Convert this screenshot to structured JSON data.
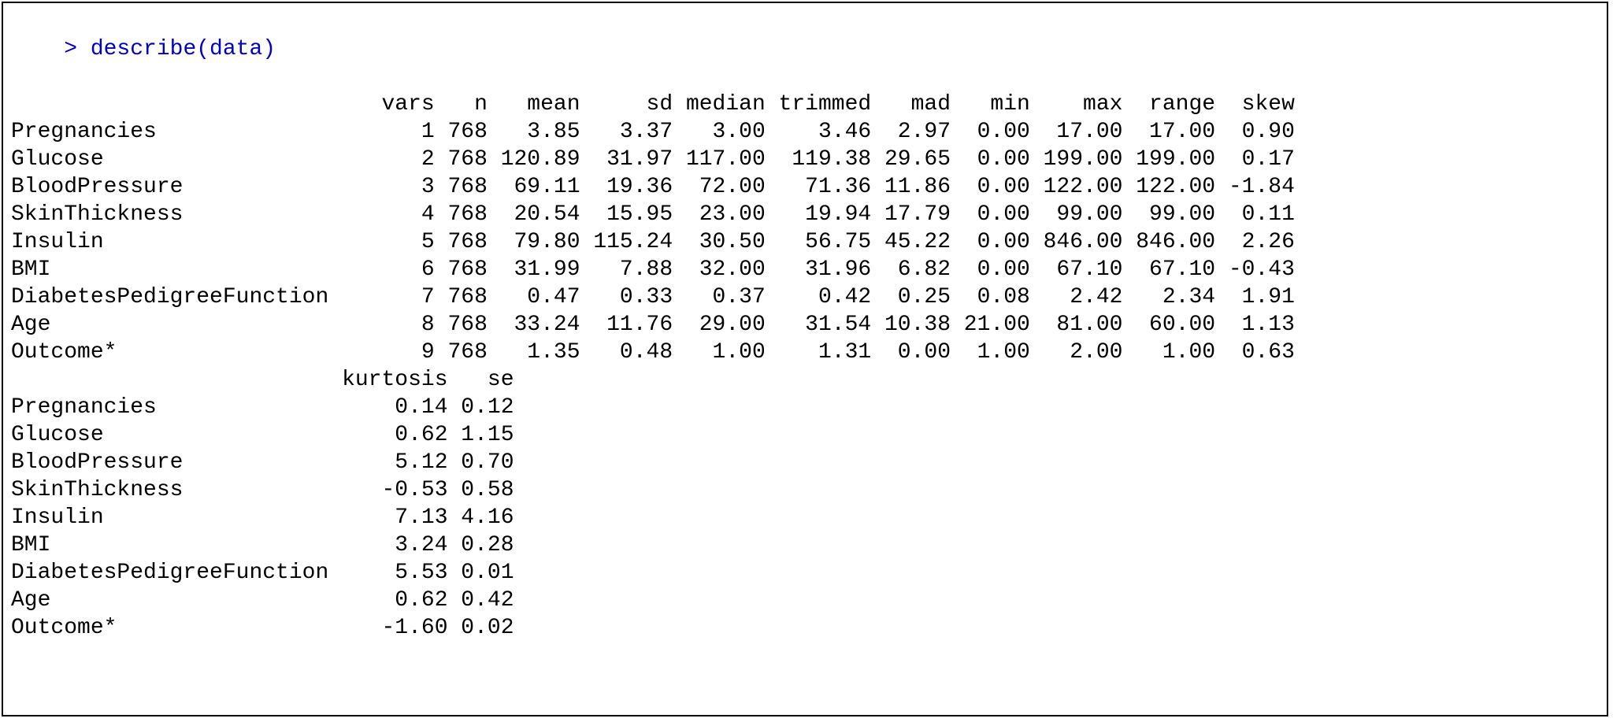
{
  "prompt_symbol": "> ",
  "command": "describe(data)",
  "block1": {
    "row_label_width": 24,
    "columns": [
      {
        "name": "vars",
        "width": 8
      },
      {
        "name": "n",
        "width": 4
      },
      {
        "name": "mean",
        "width": 7
      },
      {
        "name": "sd",
        "width": 7
      },
      {
        "name": "median",
        "width": 7
      },
      {
        "name": "trimmed",
        "width": 8
      },
      {
        "name": "mad",
        "width": 6
      },
      {
        "name": "min",
        "width": 6
      },
      {
        "name": "max",
        "width": 7
      },
      {
        "name": "range",
        "width": 7
      },
      {
        "name": "skew",
        "width": 6
      }
    ],
    "rows": [
      {
        "label": "Pregnancies",
        "vals": [
          "1",
          "768",
          "3.85",
          "3.37",
          "3.00",
          "3.46",
          "2.97",
          "0.00",
          "17.00",
          "17.00",
          "0.90"
        ]
      },
      {
        "label": "Glucose",
        "vals": [
          "2",
          "768",
          "120.89",
          "31.97",
          "117.00",
          "119.38",
          "29.65",
          "0.00",
          "199.00",
          "199.00",
          "0.17"
        ]
      },
      {
        "label": "BloodPressure",
        "vals": [
          "3",
          "768",
          "69.11",
          "19.36",
          "72.00",
          "71.36",
          "11.86",
          "0.00",
          "122.00",
          "122.00",
          "-1.84"
        ]
      },
      {
        "label": "SkinThickness",
        "vals": [
          "4",
          "768",
          "20.54",
          "15.95",
          "23.00",
          "19.94",
          "17.79",
          "0.00",
          "99.00",
          "99.00",
          "0.11"
        ]
      },
      {
        "label": "Insulin",
        "vals": [
          "5",
          "768",
          "79.80",
          "115.24",
          "30.50",
          "56.75",
          "45.22",
          "0.00",
          "846.00",
          "846.00",
          "2.26"
        ]
      },
      {
        "label": "BMI",
        "vals": [
          "6",
          "768",
          "31.99",
          "7.88",
          "32.00",
          "31.96",
          "6.82",
          "0.00",
          "67.10",
          "67.10",
          "-0.43"
        ]
      },
      {
        "label": "DiabetesPedigreeFunction",
        "vals": [
          "7",
          "768",
          "0.47",
          "0.33",
          "0.37",
          "0.42",
          "0.25",
          "0.08",
          "2.42",
          "2.34",
          "1.91"
        ]
      },
      {
        "label": "Age",
        "vals": [
          "8",
          "768",
          "33.24",
          "11.76",
          "29.00",
          "31.54",
          "10.38",
          "21.00",
          "81.00",
          "60.00",
          "1.13"
        ]
      },
      {
        "label": "Outcome*",
        "vals": [
          "9",
          "768",
          "1.35",
          "0.48",
          "1.00",
          "1.31",
          "0.00",
          "1.00",
          "2.00",
          "1.00",
          "0.63"
        ]
      }
    ]
  },
  "block2": {
    "row_label_width": 24,
    "columns": [
      {
        "name": "kurtosis",
        "width": 9
      },
      {
        "name": "se",
        "width": 5
      }
    ],
    "rows": [
      {
        "label": "Pregnancies",
        "vals": [
          "0.14",
          "0.12"
        ]
      },
      {
        "label": "Glucose",
        "vals": [
          "0.62",
          "1.15"
        ]
      },
      {
        "label": "BloodPressure",
        "vals": [
          "5.12",
          "0.70"
        ]
      },
      {
        "label": "SkinThickness",
        "vals": [
          "-0.53",
          "0.58"
        ]
      },
      {
        "label": "Insulin",
        "vals": [
          "7.13",
          "4.16"
        ]
      },
      {
        "label": "BMI",
        "vals": [
          "3.24",
          "0.28"
        ]
      },
      {
        "label": "DiabetesPedigreeFunction",
        "vals": [
          "5.53",
          "0.01"
        ]
      },
      {
        "label": "Age",
        "vals": [
          "0.62",
          "0.42"
        ]
      },
      {
        "label": "Outcome*",
        "vals": [
          "-1.60",
          "0.02"
        ]
      }
    ]
  }
}
